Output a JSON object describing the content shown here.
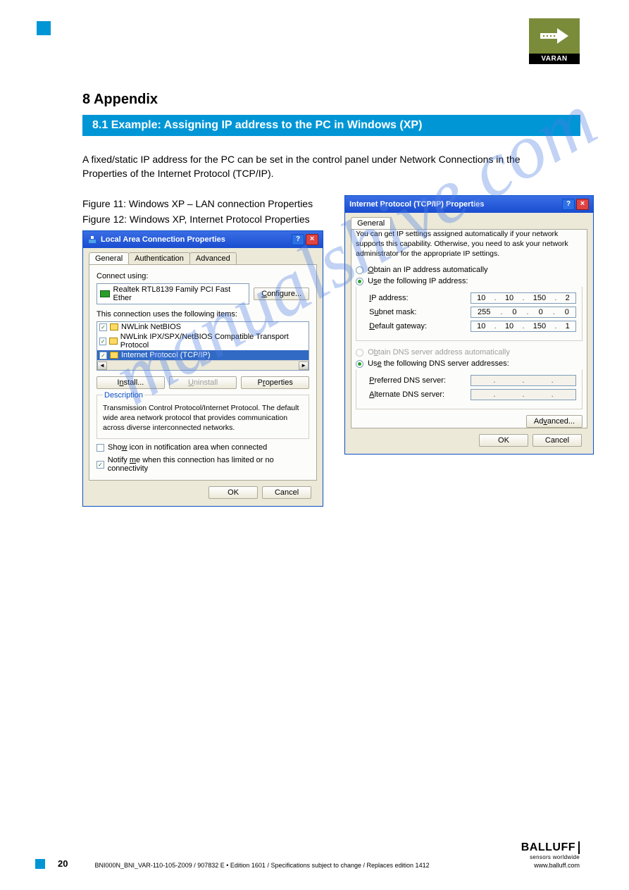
{
  "header": {
    "logo_text": "VARAN"
  },
  "section": {
    "num_title": "8 Appendix",
    "bar_text": "8.1 Example: Assigning IP address to the PC in Windows (XP)",
    "intro": "A fixed/static IP address for the PC can be set in the control panel under Network Connections in the Properties of the Internet Protocol (TCP/IP).",
    "caption_left": "Figure 11: Windows XP – LAN connection Properties",
    "caption_right": "Figure 12: Windows XP, Internet Protocol Properties"
  },
  "dialog1": {
    "title": "Local Area Connection Properties",
    "tabs": [
      "General",
      "Authentication",
      "Advanced"
    ],
    "connect_using_label": "Connect using:",
    "adapter": "Realtek RTL8139 Family PCI Fast Ether",
    "configure_btn": "Configure...",
    "items_label": "This connection uses the following items:",
    "items": [
      "NWLink NetBIOS",
      "NWLink IPX/SPX/NetBIOS Compatible Transport Protocol",
      "Internet Protocol (TCP/IP)"
    ],
    "install_btn": "Install...",
    "uninstall_btn": "Uninstall",
    "properties_btn": "Properties",
    "desc_legend": "Description",
    "desc_body": "Transmission Control Protocol/Internet Protocol. The default wide area network protocol that provides communication across diverse interconnected networks.",
    "chk_showicon": "Show icon in notification area when connected",
    "chk_notify": "Notify me when this connection has limited or no connectivity",
    "ok": "OK",
    "cancel": "Cancel"
  },
  "dialog2": {
    "title": "Internet Protocol (TCP/IP) Properties",
    "tab": "General",
    "desc": "You can get IP settings assigned automatically if your network supports this capability. Otherwise, you need to ask your network administrator for the appropriate IP settings.",
    "opt_auto_ip": "Obtain an IP address automatically",
    "opt_use_ip": "Use the following IP address:",
    "lbl_ip": "IP address:",
    "ip": [
      "10",
      "10",
      "150",
      "2"
    ],
    "lbl_subnet": "Subnet mask:",
    "subnet": [
      "255",
      "0",
      "0",
      "0"
    ],
    "lbl_gateway": "Default gateway:",
    "gateway": [
      "10",
      "10",
      "150",
      "1"
    ],
    "opt_auto_dns": "Obtain DNS server address automatically",
    "opt_use_dns": "Use the following DNS server addresses:",
    "lbl_pref_dns": "Preferred DNS server:",
    "lbl_alt_dns": "Alternate DNS server:",
    "advanced_btn": "Advanced...",
    "ok": "OK",
    "cancel": "Cancel"
  },
  "footer": {
    "left_line": "BNI000N_BNI_VAR-110-105-Z009 / 907832 E • Edition 1601 / Specifications subject to change / Replaces edition 1412",
    "page": "20",
    "balluff": "BALLUFF",
    "tagline": "sensors worldwide",
    "web": "www.balluff.com"
  },
  "watermark": "manualshive.com"
}
